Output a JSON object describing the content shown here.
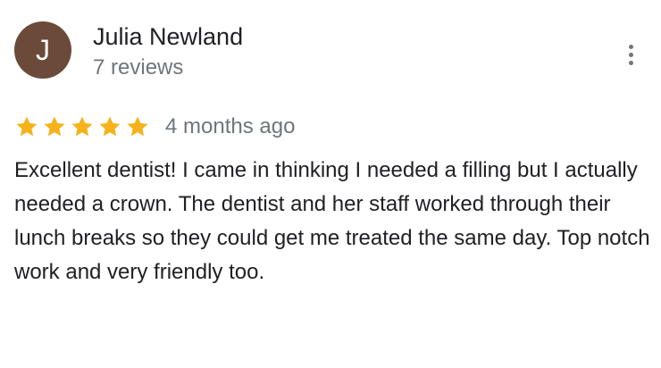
{
  "review": {
    "avatar_letter": "J",
    "avatar_color": "#6b4a3a",
    "author_name": "Julia Newland",
    "review_count": "7 reviews",
    "rating": 5,
    "rating_max": 5,
    "star_color": "#f5b31b",
    "date": "4 months ago",
    "text": "Excellent dentist! I came in thinking I needed a filling but I actually needed a crown. The dentist and her staff worked through their lunch breaks so they could get me treated the same day. Top notch work and very friendly too.",
    "more_icon": "more-vert-icon"
  }
}
